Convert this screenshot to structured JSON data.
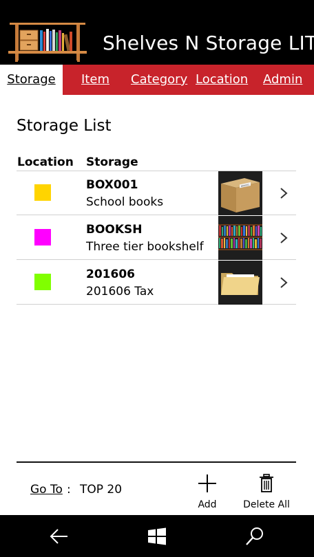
{
  "app": {
    "title": "Shelves N Storage LITE"
  },
  "tabs": [
    {
      "label": "Storage",
      "active": true
    },
    {
      "label": "Item",
      "active": false
    },
    {
      "label": "Category",
      "active": false
    },
    {
      "label": "Location",
      "active": false
    },
    {
      "label": "Admin",
      "active": false
    }
  ],
  "page": {
    "title": "Storage List"
  },
  "table": {
    "headers": {
      "location": "Location",
      "storage": "Storage"
    },
    "rows": [
      {
        "code": "BOX001",
        "description": "School books",
        "location_color": "#ffd400",
        "thumbnail_icon": "cardboard-box-icon"
      },
      {
        "code": "BOOKSH",
        "description": "Three tier bookshelf",
        "location_color": "#ff00ff",
        "thumbnail_icon": "bookshelf-icon"
      },
      {
        "code": "201606",
        "description": "201606 Tax",
        "location_color": "#80ff00",
        "thumbnail_icon": "folder-icon"
      }
    ]
  },
  "footer": {
    "goto_label": "Go To",
    "goto_separator": ":",
    "goto_value": "TOP 20",
    "add_label": "Add",
    "delete_all_label": "Delete All"
  },
  "navbar": {
    "icons": [
      "back-arrow-icon",
      "windows-start-icon",
      "search-icon"
    ]
  },
  "colors": {
    "accent": "#c8232b",
    "header_bg": "#000000"
  }
}
